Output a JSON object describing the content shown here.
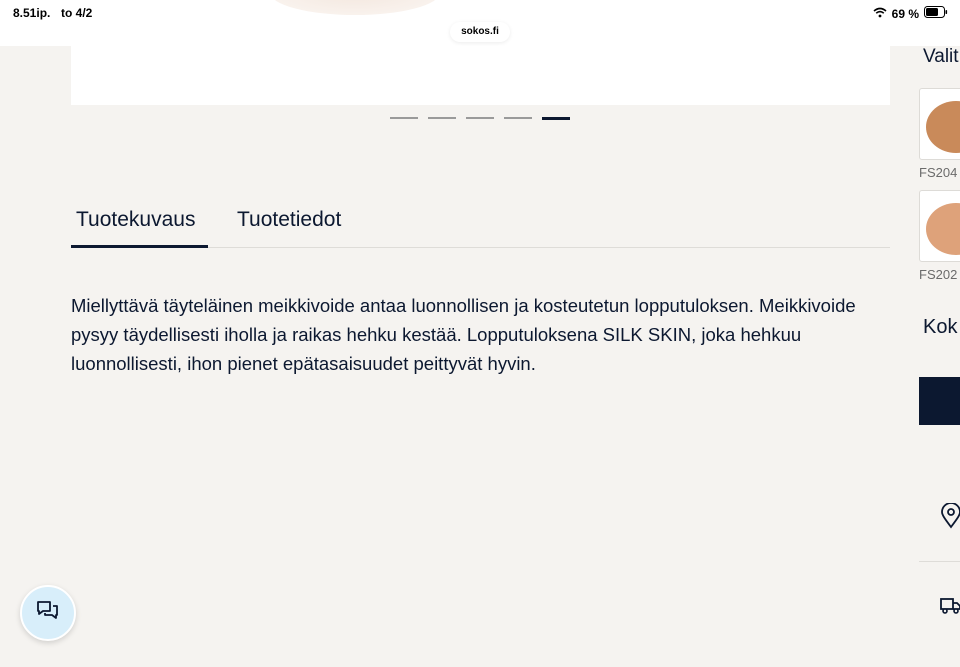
{
  "status_bar": {
    "time": "8.51ip.",
    "date": "to 4/2",
    "battery": "69 %",
    "url": "sokos.fi"
  },
  "carousel": {
    "dot_count": 5,
    "active_index": 4
  },
  "tabs": [
    {
      "label": "Tuotekuvaus",
      "active": true
    },
    {
      "label": "Tuotetiedot",
      "active": false
    }
  ],
  "description": "Miellyttävä täyteläinen meikkivoide antaa luonnollisen ja kosteutetun lopputuloksen. Meikkivoide pysyy täydellisesti iholla ja raikas hehku kestää. Lopputuloksena SILK SKIN, joka hehkuu luonnollisesti, ihon pienet epätasaisuudet peittyvät hyvin.",
  "sidebar": {
    "title": "Valit",
    "swatches": [
      {
        "code": "FS204",
        "color": "#c98a5a"
      },
      {
        "code": "FS202",
        "color": "#dea27a"
      }
    ],
    "size_label": "Kok",
    "icons": [
      "location-pin-icon",
      "delivery-truck-icon"
    ]
  },
  "chat": {
    "icon": "chat-bubbles-icon"
  },
  "colors": {
    "navy": "#0c1830",
    "background": "#f5f3f0",
    "chat_fab": "#d8eefa"
  }
}
